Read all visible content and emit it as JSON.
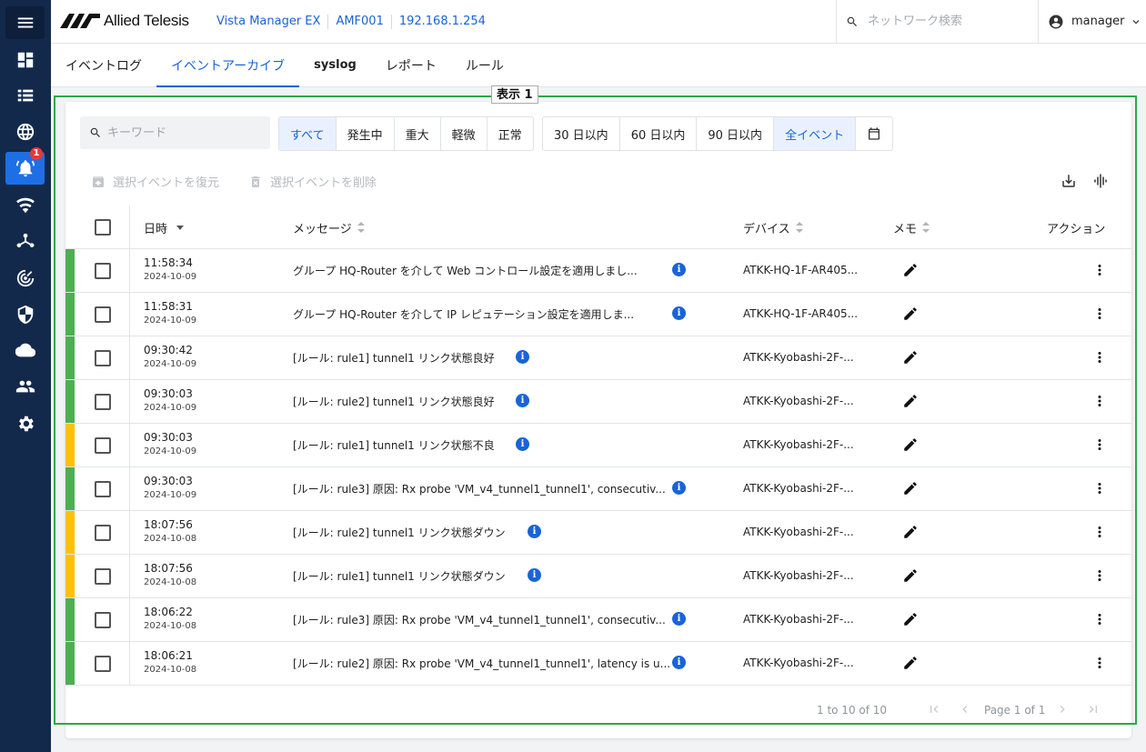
{
  "header": {
    "brand": "Allied Telesis",
    "crumbs": [
      "Vista Manager EX",
      "AMF001",
      "192.168.1.254"
    ],
    "search_placeholder": "ネットワーク検索",
    "user": "manager"
  },
  "sidebar": {
    "items": [
      {
        "name": "menu",
        "icon": "hamburger-icon"
      },
      {
        "name": "dashboard",
        "icon": "dashboard-icon"
      },
      {
        "name": "list",
        "icon": "list-icon"
      },
      {
        "name": "network",
        "icon": "globe-icon"
      },
      {
        "name": "events",
        "icon": "bell-icon",
        "badge": "1",
        "active": true
      },
      {
        "name": "wireless",
        "icon": "wifi-icon"
      },
      {
        "name": "topology",
        "icon": "topology-icon"
      },
      {
        "name": "radar",
        "icon": "radar-icon"
      },
      {
        "name": "security",
        "icon": "shield-icon"
      },
      {
        "name": "cloud",
        "icon": "cloud-icon"
      },
      {
        "name": "users",
        "icon": "users-icon"
      },
      {
        "name": "settings",
        "icon": "gear-icon"
      }
    ]
  },
  "tabs": [
    "イベントログ",
    "イベントアーカイブ",
    "syslog",
    "レポート",
    "ルール"
  ],
  "frame_label": "表示 1",
  "filters": {
    "keyword_placeholder": "キーワード",
    "severity": [
      "すべて",
      "発生中",
      "重大",
      "軽微",
      "正常"
    ],
    "period": [
      "30 日以内",
      "60 日以内",
      "90 日以内",
      "全イベント"
    ]
  },
  "toolbar": {
    "restore": "選択イベントを復元",
    "delete": "選択イベントを削除"
  },
  "table": {
    "columns": {
      "datetime": "日時",
      "message": "メッセージ",
      "device": "デバイス",
      "memo": "メモ",
      "action": "アクション"
    },
    "rows": [
      {
        "severity": "#4caf50",
        "time": "11:58:34",
        "date": "2024-10-09",
        "message": "グループ HQ-Router を介して Web コントロール設定を適用しまし...",
        "device": "ATKK-HQ-1F-AR405..."
      },
      {
        "severity": "#4caf50",
        "time": "11:58:31",
        "date": "2024-10-09",
        "message": "グループ HQ-Router を介して IP レピュテーション設定を適用しま...",
        "device": "ATKK-HQ-1F-AR405..."
      },
      {
        "severity": "#4caf50",
        "time": "09:30:42",
        "date": "2024-10-09",
        "message": "[ルール: rule1] tunnel1 リンク状態良好",
        "device": "ATKK-Kyobashi-2F-..."
      },
      {
        "severity": "#4caf50",
        "time": "09:30:03",
        "date": "2024-10-09",
        "message": "[ルール: rule2] tunnel1 リンク状態良好",
        "device": "ATKK-Kyobashi-2F-..."
      },
      {
        "severity": "#ffc107",
        "time": "09:30:03",
        "date": "2024-10-09",
        "message": "[ルール: rule1] tunnel1 リンク状態不良",
        "device": "ATKK-Kyobashi-2F-..."
      },
      {
        "severity": "#4caf50",
        "time": "09:30:03",
        "date": "2024-10-09",
        "message": "[ルール: rule3] 原因: Rx probe 'VM_v4_tunnel1_tunnel1', consecutiv...",
        "device": "ATKK-Kyobashi-2F-..."
      },
      {
        "severity": "#ffc107",
        "time": "18:07:56",
        "date": "2024-10-08",
        "message": "[ルール: rule2] tunnel1 リンク状態ダウン",
        "device": "ATKK-Kyobashi-2F-..."
      },
      {
        "severity": "#ffc107",
        "time": "18:07:56",
        "date": "2024-10-08",
        "message": "[ルール: rule1] tunnel1 リンク状態ダウン",
        "device": "ATKK-Kyobashi-2F-..."
      },
      {
        "severity": "#4caf50",
        "time": "18:06:22",
        "date": "2024-10-08",
        "message": "[ルール: rule3] 原因: Rx probe 'VM_v4_tunnel1_tunnel1', consecutiv...",
        "device": "ATKK-Kyobashi-2F-..."
      },
      {
        "severity": "#4caf50",
        "time": "18:06:21",
        "date": "2024-10-08",
        "message": "[ルール: rule2] 原因: Rx probe 'VM_v4_tunnel1_tunnel1', latency is u...",
        "device": "ATKK-Kyobashi-2F-..."
      }
    ]
  },
  "pager": {
    "range": "1 to 10 of 10",
    "page": "Page 1 of 1"
  }
}
